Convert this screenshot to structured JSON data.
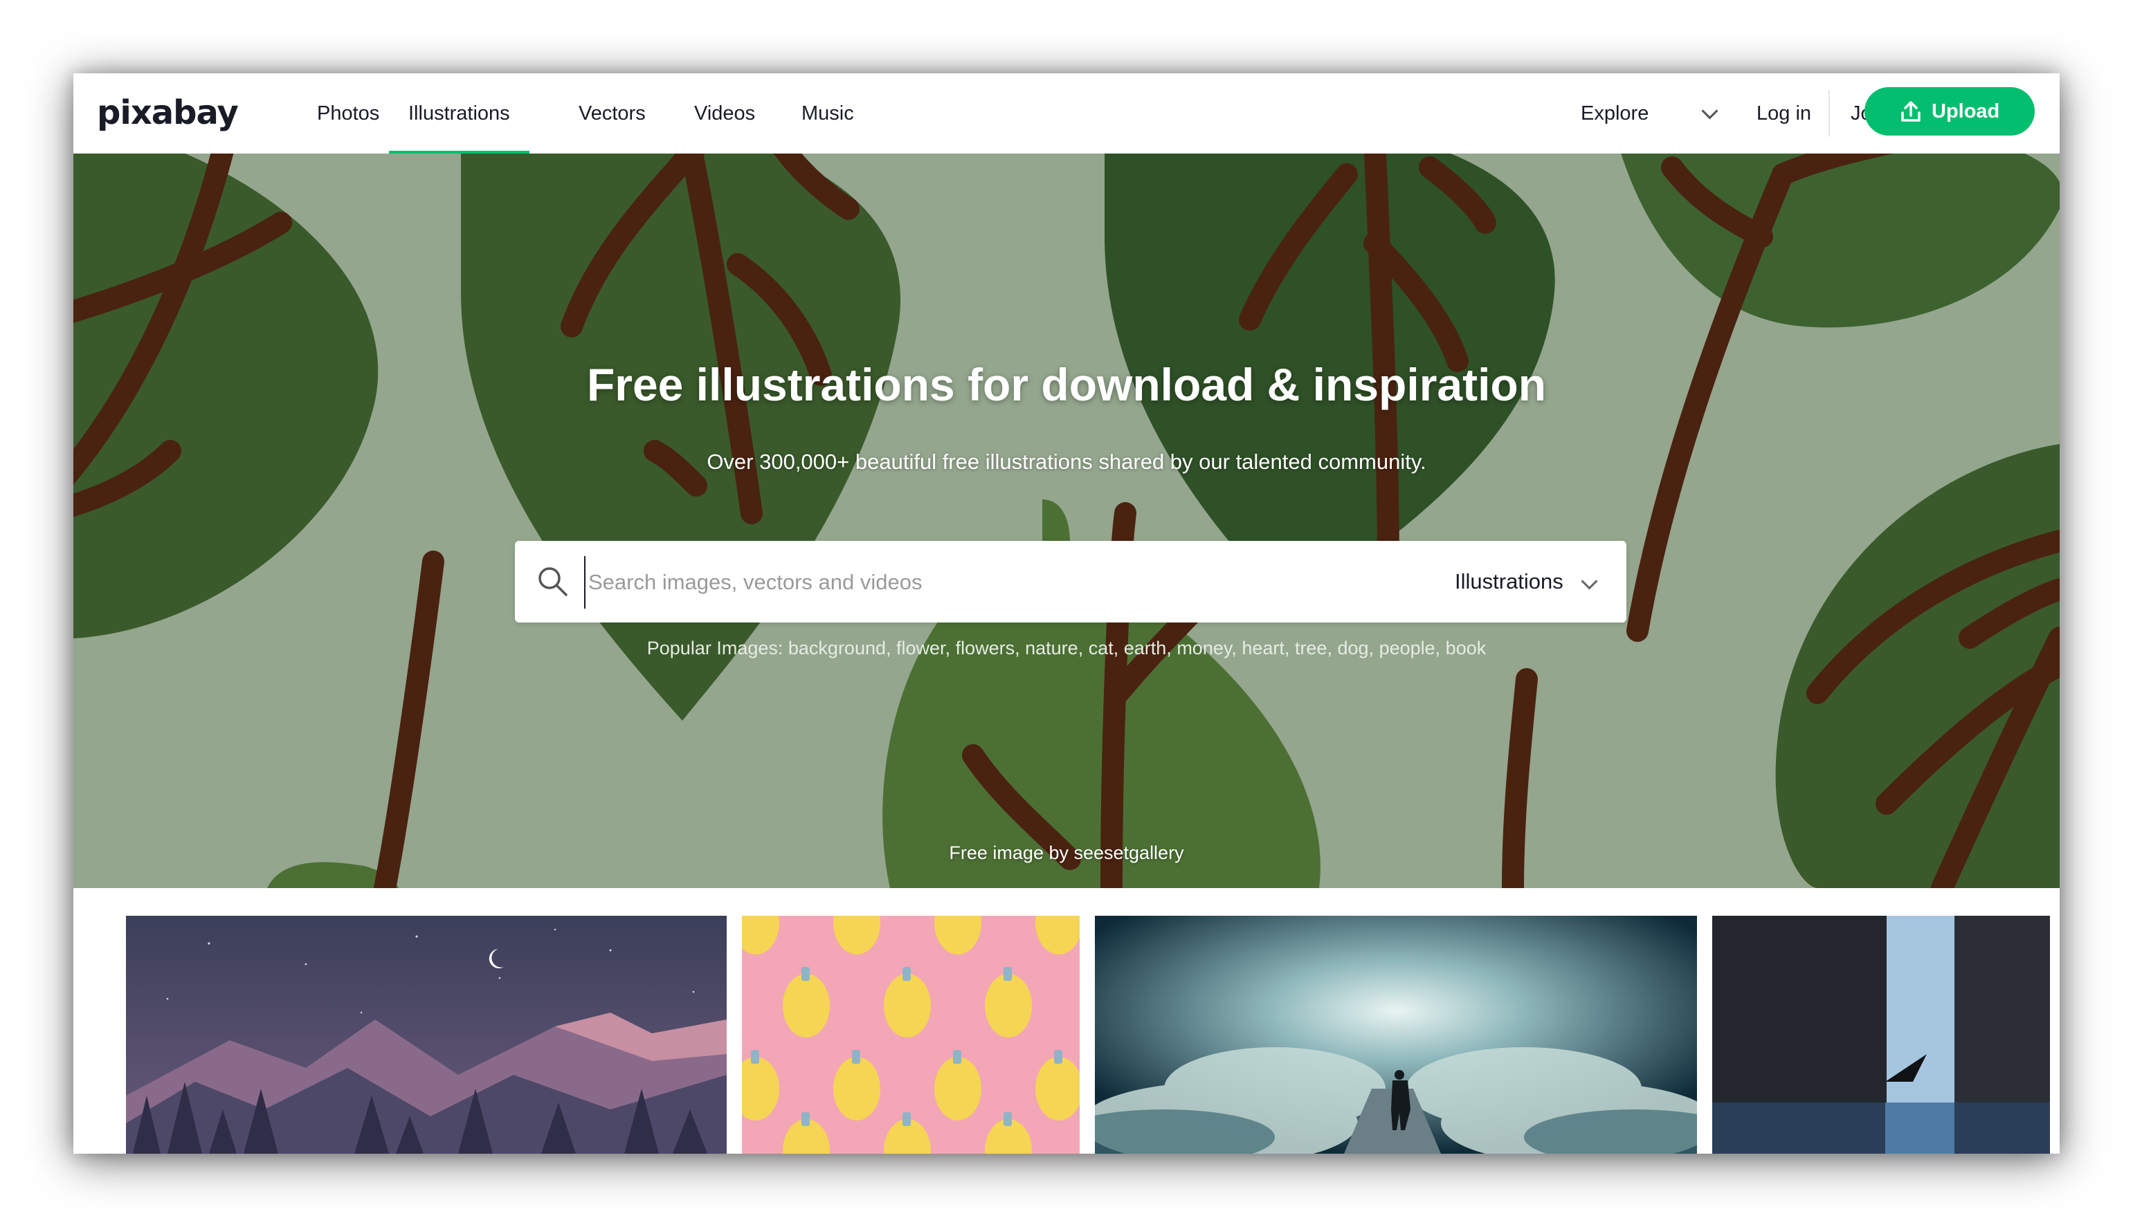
{
  "nav": {
    "logo": "pixabay",
    "links": [
      "Photos",
      "Illustrations",
      "Vectors",
      "Videos",
      "Music"
    ],
    "active": "Illustrations",
    "explore": "Explore",
    "login": "Log in",
    "join": "Join",
    "upload": "Upload"
  },
  "hero": {
    "title": "Free illustrations for download & inspiration",
    "subtitle": "Over 300,000+ beautiful free illustrations shared by our talented community.",
    "search": {
      "placeholder": "Search images, vectors and videos",
      "type": "Illustrations"
    },
    "popular_label": "Popular Images:",
    "popular_tags": [
      "background",
      "flower",
      "flowers",
      "nature",
      "cat",
      "earth",
      "money",
      "heart",
      "tree",
      "dog",
      "people",
      "book"
    ],
    "credit": "Free image by seesetgallery"
  },
  "colors": {
    "accent": "#02be6e",
    "hero_bg": "#94a68d",
    "leaf_dark": "#3a5a2b",
    "leaf_mid": "#4c7034",
    "stem": "#4a2210"
  },
  "icons": {
    "search": "search-icon",
    "upload": "upload-icon",
    "explore": "chevron-down-icon"
  }
}
